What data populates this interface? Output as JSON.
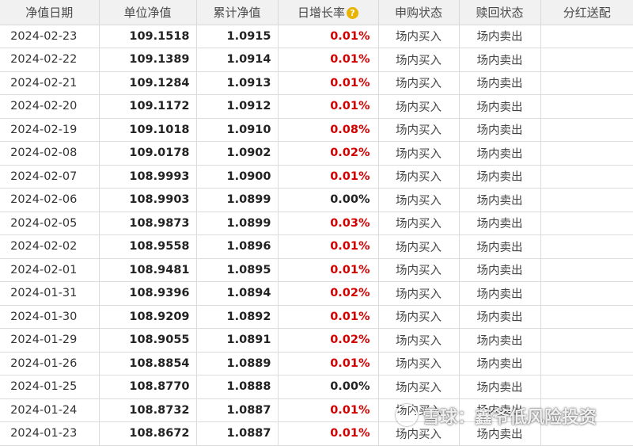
{
  "headers": {
    "date": "净值日期",
    "unit_nav": "单位净值",
    "acc_nav": "累计净值",
    "daily_growth": "日增长率",
    "subscribe": "申购状态",
    "redeem": "赎回状态",
    "dividend": "分红送配"
  },
  "help_icon": {
    "icon": "question-mark-icon",
    "glyph": "?",
    "color": "#e8b400"
  },
  "colors": {
    "up": "#d40000",
    "flat": "#222222",
    "header_bg": "#f1f1f1"
  },
  "rows": [
    {
      "date": "2024-02-23",
      "unit_nav": "109.1518",
      "acc_nav": "1.0915",
      "growth": "0.01%",
      "subscribe": "场内买入",
      "redeem": "场内卖出",
      "dividend": ""
    },
    {
      "date": "2024-02-22",
      "unit_nav": "109.1389",
      "acc_nav": "1.0914",
      "growth": "0.01%",
      "subscribe": "场内买入",
      "redeem": "场内卖出",
      "dividend": ""
    },
    {
      "date": "2024-02-21",
      "unit_nav": "109.1284",
      "acc_nav": "1.0913",
      "growth": "0.01%",
      "subscribe": "场内买入",
      "redeem": "场内卖出",
      "dividend": ""
    },
    {
      "date": "2024-02-20",
      "unit_nav": "109.1172",
      "acc_nav": "1.0912",
      "growth": "0.01%",
      "subscribe": "场内买入",
      "redeem": "场内卖出",
      "dividend": ""
    },
    {
      "date": "2024-02-19",
      "unit_nav": "109.1018",
      "acc_nav": "1.0910",
      "growth": "0.08%",
      "subscribe": "场内买入",
      "redeem": "场内卖出",
      "dividend": ""
    },
    {
      "date": "2024-02-08",
      "unit_nav": "109.0178",
      "acc_nav": "1.0902",
      "growth": "0.02%",
      "subscribe": "场内买入",
      "redeem": "场内卖出",
      "dividend": ""
    },
    {
      "date": "2024-02-07",
      "unit_nav": "108.9993",
      "acc_nav": "1.0900",
      "growth": "0.01%",
      "subscribe": "场内买入",
      "redeem": "场内卖出",
      "dividend": ""
    },
    {
      "date": "2024-02-06",
      "unit_nav": "108.9903",
      "acc_nav": "1.0899",
      "growth": "0.00%",
      "subscribe": "场内买入",
      "redeem": "场内卖出",
      "dividend": ""
    },
    {
      "date": "2024-02-05",
      "unit_nav": "108.9873",
      "acc_nav": "1.0899",
      "growth": "0.03%",
      "subscribe": "场内买入",
      "redeem": "场内卖出",
      "dividend": ""
    },
    {
      "date": "2024-02-02",
      "unit_nav": "108.9558",
      "acc_nav": "1.0896",
      "growth": "0.01%",
      "subscribe": "场内买入",
      "redeem": "场内卖出",
      "dividend": ""
    },
    {
      "date": "2024-02-01",
      "unit_nav": "108.9481",
      "acc_nav": "1.0895",
      "growth": "0.01%",
      "subscribe": "场内买入",
      "redeem": "场内卖出",
      "dividend": ""
    },
    {
      "date": "2024-01-31",
      "unit_nav": "108.9396",
      "acc_nav": "1.0894",
      "growth": "0.02%",
      "subscribe": "场内买入",
      "redeem": "场内卖出",
      "dividend": ""
    },
    {
      "date": "2024-01-30",
      "unit_nav": "108.9209",
      "acc_nav": "1.0892",
      "growth": "0.01%",
      "subscribe": "场内买入",
      "redeem": "场内卖出",
      "dividend": ""
    },
    {
      "date": "2024-01-29",
      "unit_nav": "108.9055",
      "acc_nav": "1.0891",
      "growth": "0.02%",
      "subscribe": "场内买入",
      "redeem": "场内卖出",
      "dividend": ""
    },
    {
      "date": "2024-01-26",
      "unit_nav": "108.8854",
      "acc_nav": "1.0889",
      "growth": "0.01%",
      "subscribe": "场内买入",
      "redeem": "场内卖出",
      "dividend": ""
    },
    {
      "date": "2024-01-25",
      "unit_nav": "108.8770",
      "acc_nav": "1.0888",
      "growth": "0.00%",
      "subscribe": "场内买入",
      "redeem": "场内卖出",
      "dividend": ""
    },
    {
      "date": "2024-01-24",
      "unit_nav": "108.8732",
      "acc_nav": "1.0887",
      "growth": "0.01%",
      "subscribe": "场内买入",
      "redeem": "场内卖出",
      "dividend": ""
    },
    {
      "date": "2024-01-23",
      "unit_nav": "108.8672",
      "acc_nav": "1.0887",
      "growth": "0.01%",
      "subscribe": "场内买入",
      "redeem": "场内卖出",
      "dividend": ""
    }
  ],
  "watermark": {
    "text": "雪球：鑫爷低风险投资",
    "icon": "snowball-logo-icon"
  }
}
